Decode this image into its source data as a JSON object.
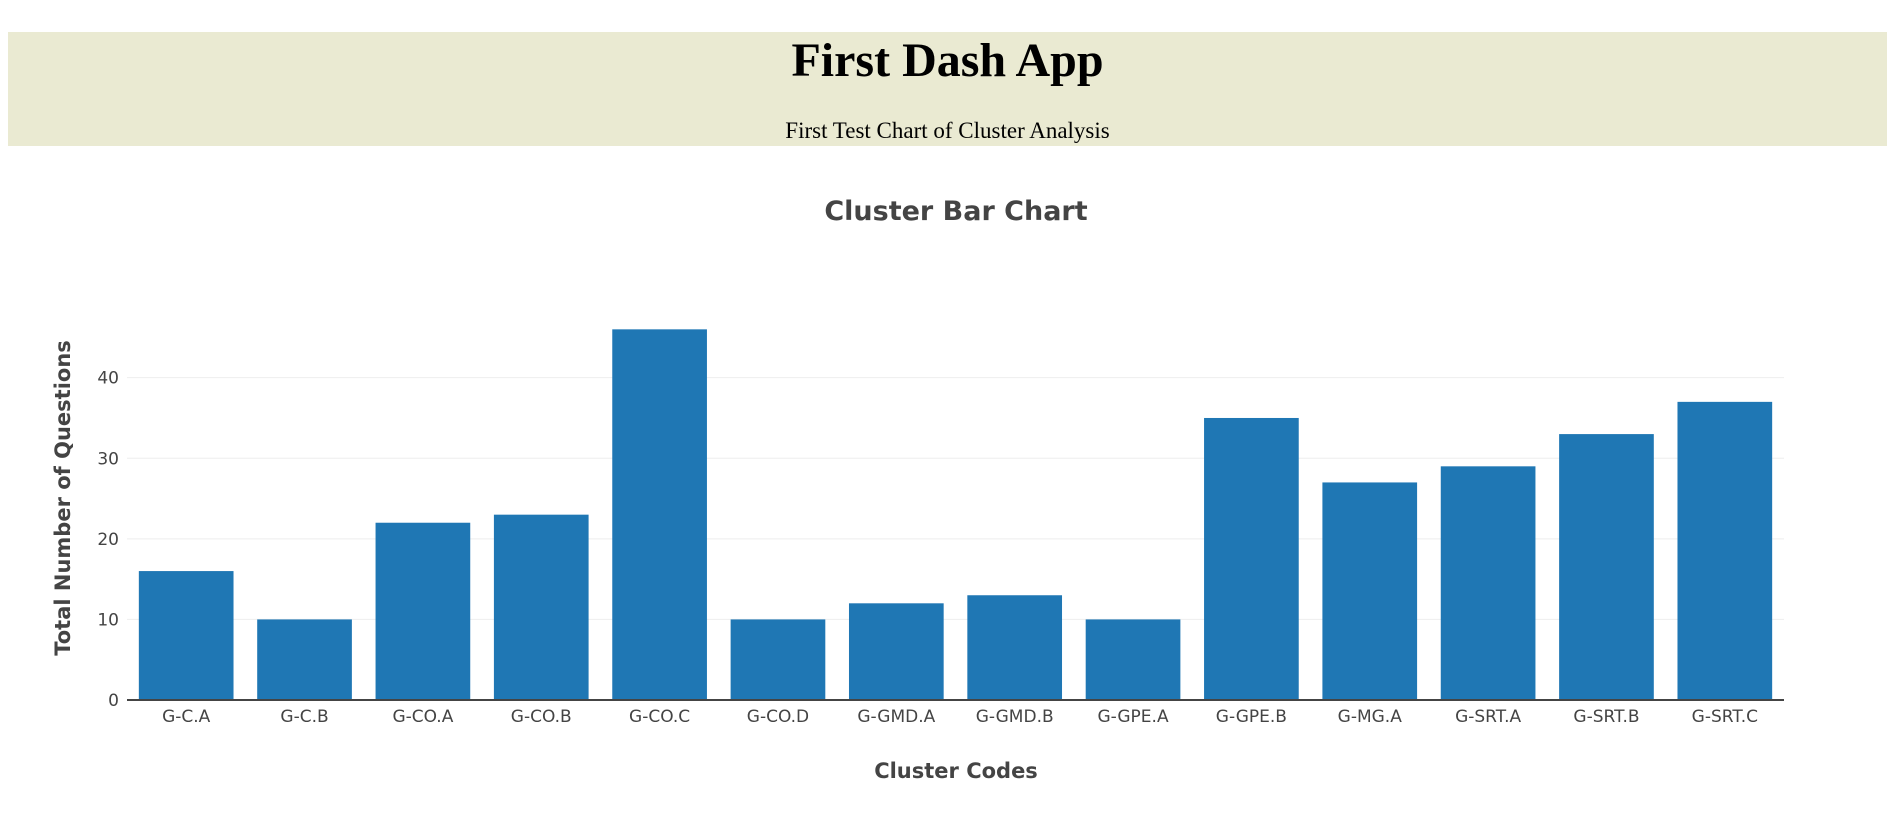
{
  "header": {
    "title": "First Dash App",
    "subtitle": "First Test Chart of Cluster Analysis",
    "background": "#eaeaD2"
  },
  "chart_data": {
    "type": "bar",
    "title": "Cluster Bar Chart",
    "xlabel": "Cluster Codes",
    "ylabel": "Total Number of Questions",
    "categories": [
      "G-C.A",
      "G-C.B",
      "G-CO.A",
      "G-CO.B",
      "G-CO.C",
      "G-CO.D",
      "G-GMD.A",
      "G-GMD.B",
      "G-GPE.A",
      "G-GPE.B",
      "G-MG.A",
      "G-SRT.A",
      "G-SRT.B",
      "G-SRT.C"
    ],
    "values": [
      16,
      10,
      22,
      23,
      46,
      10,
      12,
      13,
      10,
      35,
      27,
      29,
      33,
      37
    ],
    "ylim": [
      0,
      48.4
    ],
    "yticks": [
      0,
      10,
      20,
      30,
      40
    ],
    "grid": true,
    "legend": "none",
    "bar_color": "#1f77b4",
    "grid_color": "#eeeeee",
    "axis_color": "#444444"
  }
}
